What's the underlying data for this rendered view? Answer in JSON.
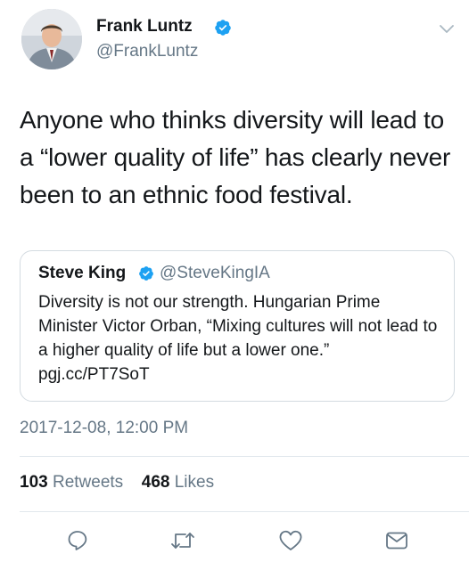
{
  "tweet": {
    "author": {
      "name": "Frank Luntz",
      "handle": "@FrankLuntz",
      "verified": true
    },
    "text": "Anyone who thinks diversity will lead to a “lower quality of life” has clearly never been to an ethnic food festival.",
    "quoted": {
      "name": "Steve King",
      "handle": "@SteveKingIA",
      "verified": true,
      "text": "Diversity is not our strength. Hungarian Prime Minister Victor Orban, “Mixing cultures will not lead to a higher quality of life but a lower one.” pgj.cc/PT7SoT"
    },
    "timestamp": "2017-12-08, 12:00 PM",
    "stats": {
      "retweets_count": "103",
      "retweets_label": "Retweets",
      "likes_count": "468",
      "likes_label": "Likes"
    }
  },
  "icons": {
    "verified": "verified-badge-icon",
    "menu": "chevron-down-icon",
    "reply": "reply-icon",
    "retweet": "retweet-icon",
    "like": "heart-icon",
    "dm": "envelope-icon"
  },
  "colors": {
    "text": "#14171a",
    "secondary": "#657786",
    "verified": "#1da1f2",
    "border": "#e1e8ed"
  }
}
